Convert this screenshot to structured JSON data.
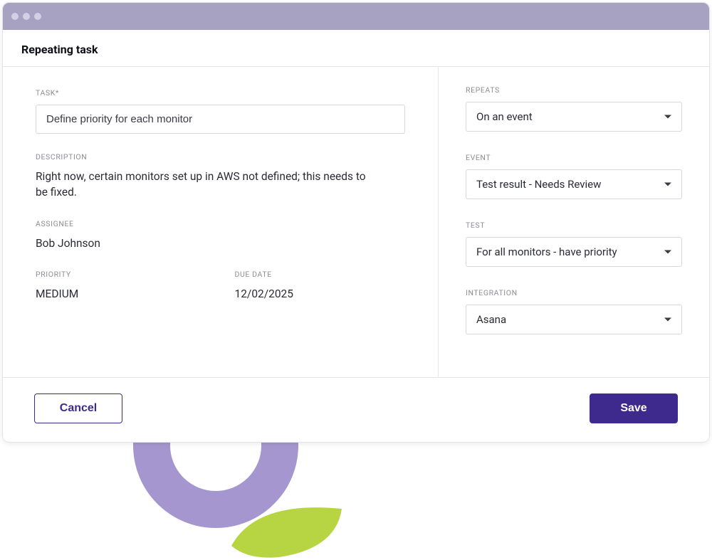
{
  "header": {
    "title": "Repeating task"
  },
  "left": {
    "task_label": "TASK*",
    "task_value": "Define priority for each monitor",
    "description_label": "DESCRIPTION",
    "description_value": "Right now, certain monitors set up in AWS not defined; this needs to be fixed.",
    "assignee_label": "ASSIGNEE",
    "assignee_value": "Bob Johnson",
    "priority_label": "PRIORITY",
    "priority_value": "MEDIUM",
    "due_date_label": "DUE DATE",
    "due_date_value": "12/02/2025"
  },
  "right": {
    "repeats_label": "REPEATS",
    "repeats_value": "On an event",
    "event_label": "EVENT",
    "event_value": "Test result - Needs Review",
    "test_label": "TEST",
    "test_value": "For all monitors - have priority",
    "integration_label": "INTEGRATION",
    "integration_value": "Asana"
  },
  "footer": {
    "cancel_label": "Cancel",
    "save_label": "Save"
  }
}
